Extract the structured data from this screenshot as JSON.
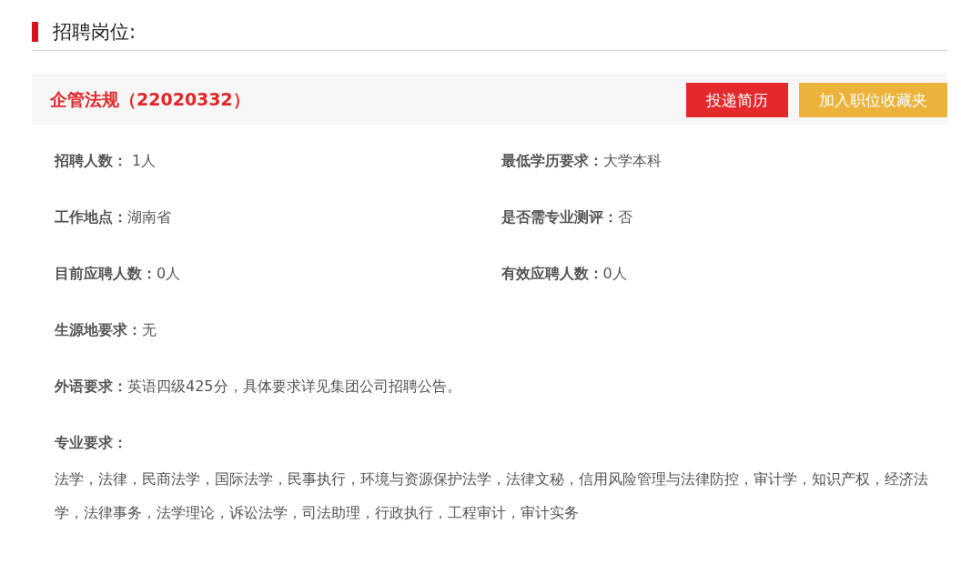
{
  "section_title": "招聘岗位:",
  "position": {
    "title": "企管法规（22020332）",
    "buttons": [
      {
        "label": "投递简历",
        "kind": "primary"
      },
      {
        "label": "加入职位收藏夹",
        "kind": "secondary"
      }
    ]
  },
  "details": [
    [
      {
        "label": "招聘人数：",
        "value": " 1人"
      },
      {
        "label": "最低学历要求：",
        "value": "大学本科"
      }
    ],
    [
      {
        "label": "工作地点：",
        "value": "湖南省"
      },
      {
        "label": "是否需专业测评：",
        "value": "否"
      }
    ],
    [
      {
        "label": "目前应聘人数：",
        "value": "0人"
      },
      {
        "label": "有效应聘人数：",
        "value": "0人"
      }
    ],
    [
      {
        "label": "生源地要求：",
        "value": "无"
      }
    ],
    [
      {
        "label": "外语要求：",
        "value": "英语四级425分，具体要求详见集团公司招聘公告。"
      }
    ]
  ],
  "major": {
    "label": "专业要求：",
    "text": "法学，法律，民商法学，国际法学，民事执行，环境与资源保护法学，法律文秘，信用风险管理与法律防控，审计学，知识产权，经济法学，法律事务，法学理论，诉讼法学，司法助理，行政执行，工程审计，审计实务"
  }
}
